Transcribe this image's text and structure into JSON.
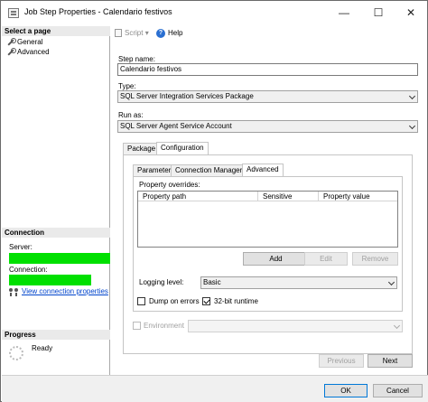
{
  "window": {
    "title": "Job Step Properties - Calendario festivos",
    "minimize_glyph": "—",
    "maximize_glyph": "☐",
    "close_glyph": "✕"
  },
  "sidebar": {
    "select_page_heading": "Select a page",
    "pages": [
      {
        "label": "General",
        "icon": "wrench-icon"
      },
      {
        "label": "Advanced",
        "icon": "wrench-icon"
      }
    ],
    "connection_heading": "Connection",
    "server_label": "Server:",
    "connection_label": "Connection:",
    "redaction_color": "#00e000",
    "view_connection_link": "View connection properties",
    "progress_heading": "Progress",
    "progress_status": "Ready"
  },
  "toolbar": {
    "script_label": "Script",
    "help_label": "Help"
  },
  "form": {
    "step_name_label": "Step name:",
    "step_name_value": "Calendario festivos",
    "type_label": "Type:",
    "type_value": "SQL Server Integration Services Package",
    "run_as_label": "Run as:",
    "run_as_value": "SQL Server Agent Service Account"
  },
  "outer_tabs": [
    "Package",
    "Configuration"
  ],
  "inner_tabs": [
    "Parameters",
    "Connection Managers",
    "Advanced"
  ],
  "advanced": {
    "property_overrides_label": "Property overrides:",
    "columns": [
      "Property path",
      "Sensitive",
      "Property value"
    ],
    "add_button": "Add",
    "edit_button": "Edit",
    "remove_button": "Remove",
    "logging_level_label": "Logging level:",
    "logging_level_value": "Basic",
    "dump_on_errors_label": "Dump on errors",
    "dump_on_errors_checked": false,
    "runtime_32bit_label": "32-bit runtime",
    "runtime_32bit_checked": true
  },
  "environment": {
    "label": "Environment",
    "value": ""
  },
  "nav_buttons": {
    "previous": "Previous",
    "next": "Next"
  },
  "dialog_buttons": {
    "ok": "OK",
    "cancel": "Cancel"
  }
}
